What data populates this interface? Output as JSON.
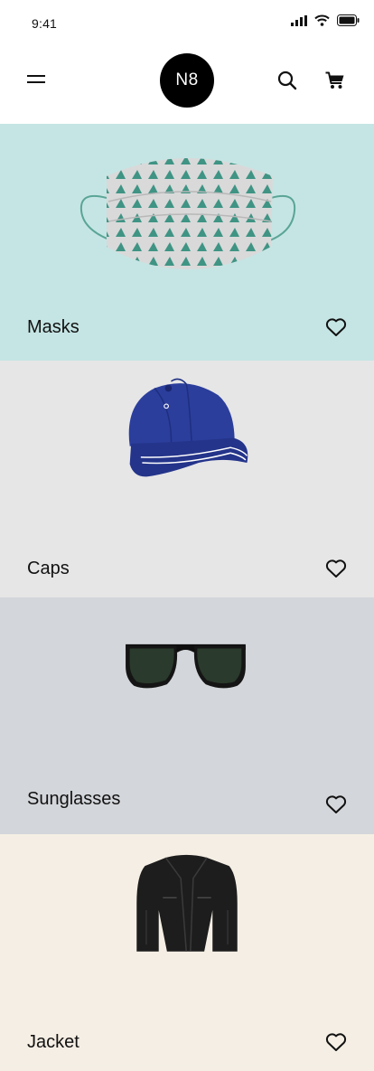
{
  "status": {
    "time": "9:41"
  },
  "header": {
    "logo_text": "N8"
  },
  "categories": [
    {
      "label": "Masks",
      "bg": "#c5e5e4",
      "icon": "mask-image"
    },
    {
      "label": "Caps",
      "bg": "#e6e6e7",
      "icon": "cap-image"
    },
    {
      "label": "Sunglasses",
      "bg": "#d3d6da",
      "icon": "sunglasses-image"
    },
    {
      "label": "Jacket",
      "bg": "#f5eee4",
      "icon": "jacket-image"
    }
  ],
  "colors": {
    "logo_bg": "#000000",
    "mask_pattern": "#2e8c7a",
    "cap_blue": "#2b3e9c"
  }
}
